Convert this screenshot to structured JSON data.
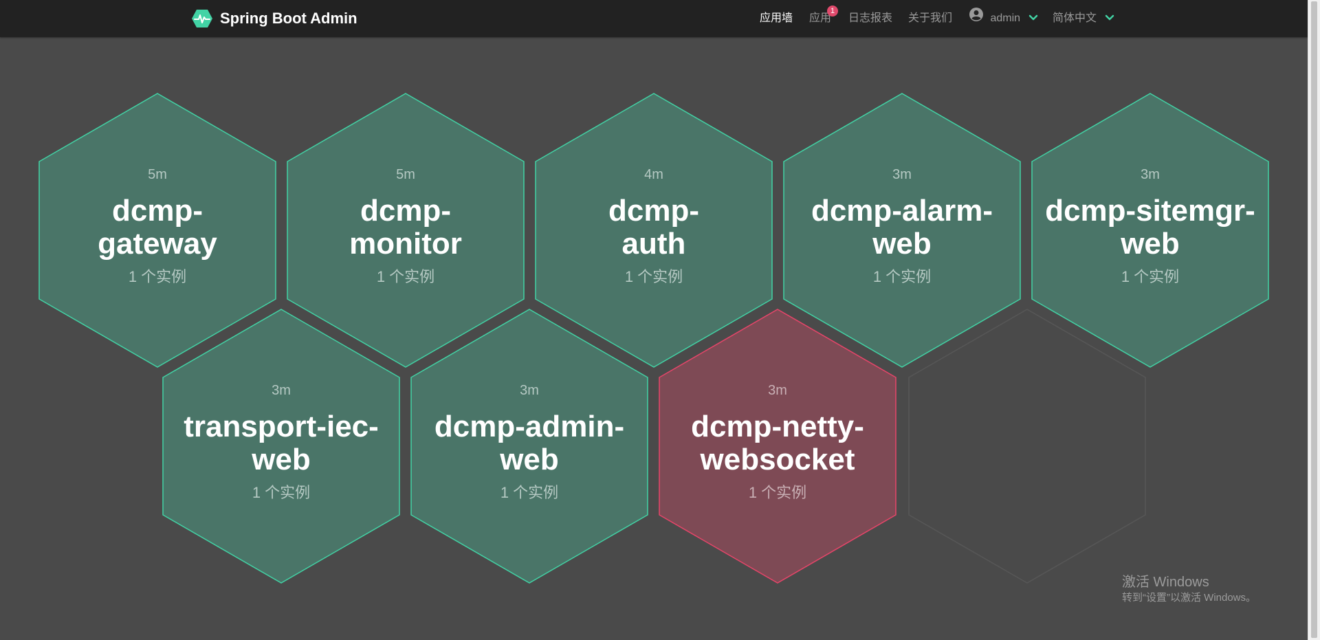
{
  "app": {
    "brand": "Spring Boot Admin",
    "brand_icon": "heartbeat-hexagon-icon",
    "accent_color": "#42d3a5",
    "up_fill": "#4a7568",
    "down_fill": "#7e4a55",
    "down_stroke": "#e8456a"
  },
  "nav": {
    "wall": "应用墙",
    "applications": "应用",
    "applications_badge": "1",
    "journal": "日志报表",
    "about": "关于我们",
    "user": "admin",
    "language": "简体中文"
  },
  "applications": [
    {
      "name_line1": "dcmp-",
      "name_line2": "gateway",
      "time": "5m",
      "instances": "1 个实例",
      "status": "up"
    },
    {
      "name_line1": "dcmp-",
      "name_line2": "monitor",
      "time": "5m",
      "instances": "1 个实例",
      "status": "up"
    },
    {
      "name_line1": "dcmp-",
      "name_line2": "auth",
      "time": "4m",
      "instances": "1 个实例",
      "status": "up"
    },
    {
      "name_line1": "dcmp-alarm-",
      "name_line2": "web",
      "time": "3m",
      "instances": "1 个实例",
      "status": "up"
    },
    {
      "name_line1": "dcmp-sitemgr-",
      "name_line2": "web",
      "time": "3m",
      "instances": "1 个实例",
      "status": "up"
    },
    {
      "name_line1": "transport-iec-",
      "name_line2": "web",
      "time": "3m",
      "instances": "1 个实例",
      "status": "up"
    },
    {
      "name_line1": "dcmp-admin-",
      "name_line2": "web",
      "time": "3m",
      "instances": "1 个实例",
      "status": "up"
    },
    {
      "name_line1": "dcmp-netty-",
      "name_line2": "websocket",
      "time": "3m",
      "instances": "1 个实例",
      "status": "down"
    }
  ],
  "watermark": {
    "line1": "激活 Windows",
    "line2": "转到“设置”以激活 Windows。"
  }
}
